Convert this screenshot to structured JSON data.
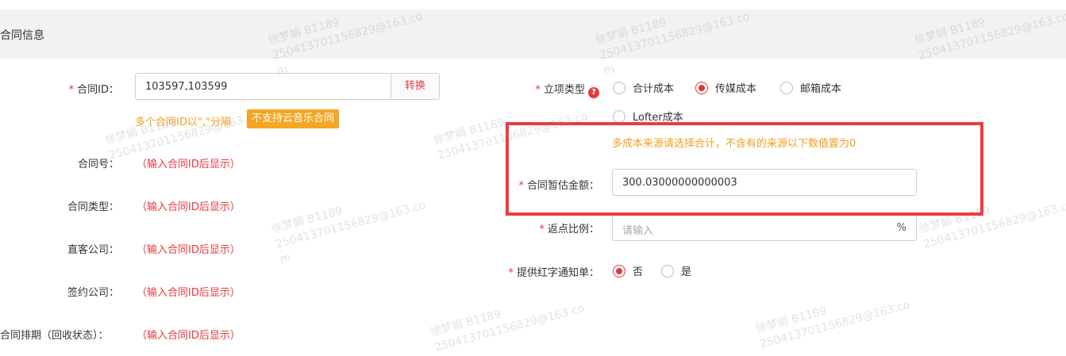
{
  "section": {
    "title": "合同信息"
  },
  "left_fields": {
    "contract_id": {
      "label": "合同ID：",
      "value": "103597,103599",
      "convert_label": "转换"
    },
    "tip": "多个合同ID以\",\"分隔",
    "tag": "不支持云音乐合同",
    "rows": [
      {
        "label": "合同号：",
        "value": "（输入合同ID后显示）"
      },
      {
        "label": "合同类型：",
        "value": "（输入合同ID后显示）"
      },
      {
        "label": "直客公司：",
        "value": "（输入合同ID后显示）"
      },
      {
        "label": "签约公司：",
        "value": "（输入合同ID后显示）"
      },
      {
        "label": "合同排期（回收状态）：",
        "value": "（输入合同ID后显示）"
      }
    ]
  },
  "right_fields": {
    "project_type": {
      "label": "立项类型",
      "help": "?",
      "options": [
        "合计成本",
        "传媒成本",
        "邮箱成本",
        "Lofter成本"
      ],
      "selected": "传媒成本"
    },
    "cost_tip": "多成本来源请选择合计，不含有的来源以下数值置为0",
    "estimate_amount": {
      "label": "合同暂估金额：",
      "value": "300.03000000000003"
    },
    "rebate_ratio": {
      "label": "返点比例：",
      "placeholder": "请输入",
      "suffix": "%"
    },
    "red_notice": {
      "label": "提供红字通知单：",
      "options": [
        "否",
        "是"
      ],
      "selected": "否"
    }
  },
  "watermark": {
    "name": "徐梦娟 B1189",
    "email": "250413701156829@163.co",
    "tail": "m"
  },
  "colors": {
    "accent": "#e4393c",
    "warning": "#f0a020",
    "highlight": "#f03a3a"
  }
}
